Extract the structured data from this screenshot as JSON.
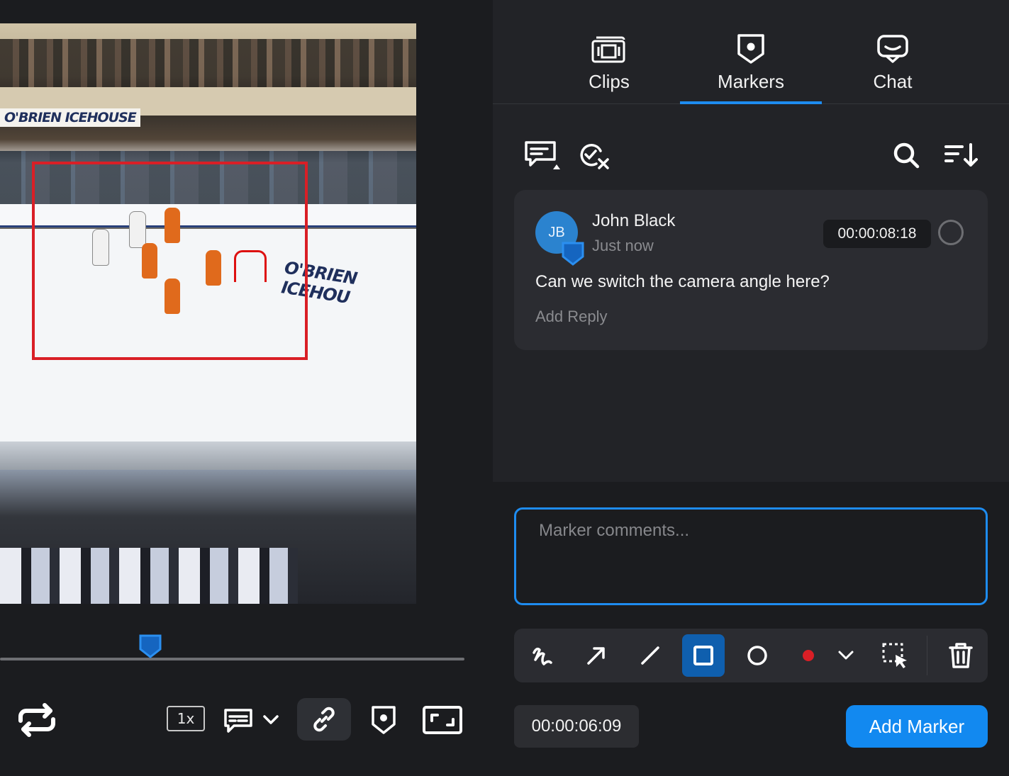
{
  "video": {
    "sign_top": "O'BRIEN ICEHOUSE",
    "sign_boards": "O'BRIEN ICEHOU"
  },
  "controls": {
    "speed_label": "1x"
  },
  "tabs": [
    {
      "label": "Clips",
      "icon": "clips-icon",
      "active": false
    },
    {
      "label": "Markers",
      "icon": "marker-icon",
      "active": true
    },
    {
      "label": "Chat",
      "icon": "chat-icon",
      "active": false
    }
  ],
  "marker": {
    "avatar_initials": "JB",
    "author": "John Black",
    "posted": "Just now",
    "timecode": "00:00:08:18",
    "comment": "Can we switch the camera angle here?",
    "add_reply": "Add Reply"
  },
  "composer": {
    "placeholder": "Marker comments...",
    "current_timecode": "00:00:06:09",
    "add_marker_label": "Add Marker",
    "active_tool": "rectangle",
    "draw_color": "#d91f26"
  },
  "colors": {
    "accent": "#1e8cf0",
    "marker_box": "#d91f26"
  }
}
